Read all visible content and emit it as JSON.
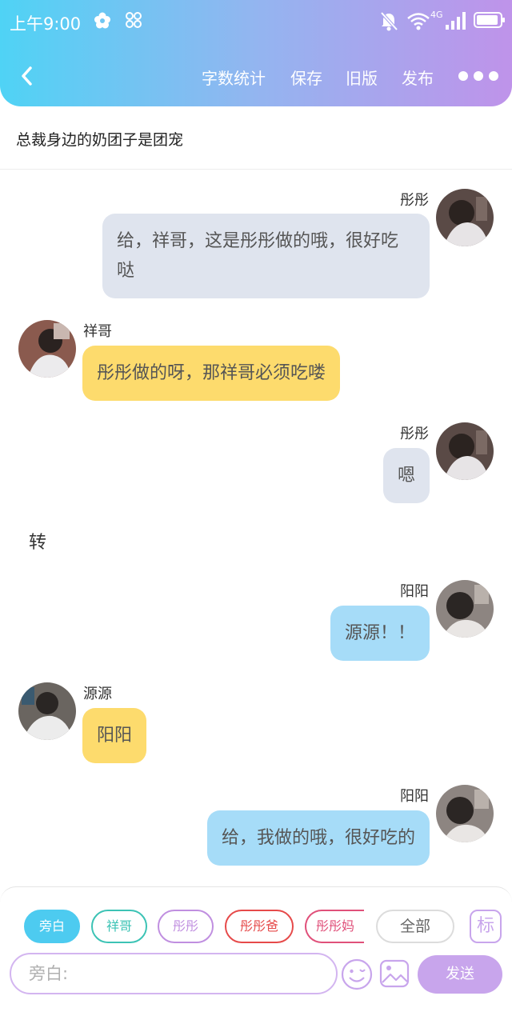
{
  "status_bar": {
    "time": "上午9:00",
    "network": "4G",
    "icons": [
      "flower-icon",
      "link-icon",
      "mute-bell-icon",
      "wifi-icon",
      "signal-icon",
      "battery-icon"
    ]
  },
  "toolbar": {
    "word_count": "字数统计",
    "save": "保存",
    "old_version": "旧版",
    "publish": "发布"
  },
  "story": {
    "title": "总裁身边的奶团子是团宠"
  },
  "messages": [
    {
      "side": "right",
      "speaker": "彤彤",
      "text": "给，祥哥，这是彤彤做的哦，很好吃哒",
      "bubble_color": "#dfe4ee"
    },
    {
      "side": "left",
      "speaker": "祥哥",
      "text": "彤彤做的呀，那祥哥必须吃喽",
      "bubble_color": "#fddb6d"
    },
    {
      "side": "right",
      "speaker": "彤彤",
      "text": "嗯",
      "bubble_color": "#dfe4ee"
    },
    {
      "side": "narration",
      "text": "转"
    },
    {
      "side": "right",
      "speaker": "阳阳",
      "text": "源源！！",
      "bubble_color": "#a6dcf8"
    },
    {
      "side": "left",
      "speaker": "源源",
      "text": "阳阳",
      "bubble_color": "#fddb6d"
    },
    {
      "side": "right",
      "speaker": "阳阳",
      "text": "给，我做的哦，很好吃的",
      "bubble_color": "#a6dcf8"
    }
  ],
  "role_chips": [
    {
      "label": "旁白",
      "color": "#4dcbf0",
      "selected": true
    },
    {
      "label": "祥哥",
      "color": "#3cc3b5",
      "selected": false
    },
    {
      "label": "彤彤",
      "color": "#c08fe0",
      "selected": false
    },
    {
      "label": "彤彤爸",
      "color": "#e64a4a",
      "selected": false
    },
    {
      "label": "彤彤妈",
      "color": "#e0507a",
      "selected": false
    },
    {
      "label": "全部",
      "color": "#dcdcdc",
      "selected": false
    }
  ],
  "mark_button": {
    "label": "标"
  },
  "composer": {
    "placeholder": "旁白:",
    "value": "",
    "send_label": "发送"
  },
  "accent_color": "#c8a5ec"
}
